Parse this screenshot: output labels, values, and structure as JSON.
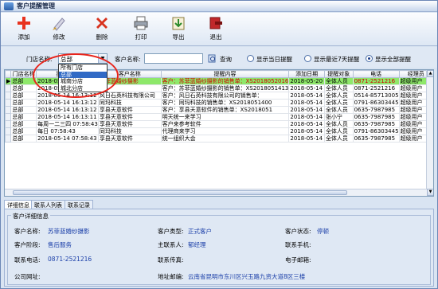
{
  "window": {
    "title": "客户提醒管理"
  },
  "toolbar": {
    "add": "添加",
    "edit": "修改",
    "delete": "删除",
    "print": "打印",
    "export": "导出",
    "exit": "退出"
  },
  "filter": {
    "store_label": "门店名称:",
    "store_value": "总部",
    "store_options": [
      "所有门店",
      "总部",
      "城南分店",
      "城北分店"
    ],
    "store_selected_index": 1,
    "customer_label": "客户名称:",
    "customer_value": "",
    "query_label": "查询",
    "radio_today": "显示当日提醒",
    "radio_week": "显示最近7天提醒",
    "radio_all": "显示全部提醒",
    "radio_selected": "radio_all"
  },
  "grid": {
    "columns": [
      "门店名称",
      "提醒时间",
      "客户名称",
      "提醒内容",
      "添加日期",
      "提醒对象",
      "电话",
      "经理员"
    ],
    "rows": [
      [
        "总部",
        "2018-05-20 15:26:38",
        "苏菲蓝婚纱摄影",
        "客户：苏菲蓝婚纱摄影的销售单：XS2018052016",
        "2018-05-20",
        "全体人员",
        "0871-2521216",
        "超级用户"
      ],
      [
        "总部",
        "2018-05-14 16:13:12",
        "",
        "客户：苏菲蓝婚纱摄影的销售单：XS2018051413",
        "2018-05-14",
        "全体人员",
        "0871-2521216",
        "超级用户"
      ],
      [
        "总部",
        "2018-05-14 16:13:12",
        "风日石英科技有限公司",
        "客户：风日石英科技有限公司的销售单：",
        "2018-05-14",
        "全体人员",
        "0514-85713005",
        "超级用户"
      ],
      [
        "总部",
        "2018-05-14 16:13:12",
        "同玛科技",
        "客户：同玛科技的销售单：XS2018051400",
        "2018-05-14",
        "全体人员",
        "0791-86303445",
        "超级用户"
      ],
      [
        "总部",
        "2018-05-14 16:13:12",
        "享县天意软件",
        "客户：享县天意软件的销售单：XS2018051",
        "2018-05-14",
        "全体人员",
        "0635-7987985",
        "超级用户"
      ],
      [
        "总部",
        "2018-05-14 16:13:11",
        "享县天意软件",
        "明天统一来学习",
        "2018-05-14",
        "张小宁",
        "0635-7987985",
        "超级用户"
      ],
      [
        "总部",
        "每周一二三四 07:58:43",
        "享县天意软件",
        "客户来参考软件",
        "2018-05-14",
        "全体人员",
        "0635-7987985",
        "超级用户"
      ],
      [
        "总部",
        "每日 07:58:43",
        "同玛科技",
        "代理商来学习",
        "2018-05-14",
        "全体人员",
        "0791-86303445",
        "超级用户"
      ],
      [
        "总部",
        "2018-05-14 07:58:43",
        "享县天意软件",
        "统一组织大会",
        "2018-05-14",
        "全体人员",
        "0635-7987985",
        "超级用户"
      ]
    ]
  },
  "tabs": [
    "详细信息",
    "联系人列表",
    "联系记录"
  ],
  "detail": {
    "section_title": "客户详细信息",
    "customer_name_label": "客户名称:",
    "customer_name": "苏菲蓝婚纱摄影",
    "customer_type_label": "客户类型:",
    "customer_type": "正式客户",
    "customer_status_label": "客户状态:",
    "customer_status": "停顿",
    "customer_stage_label": "客户阶段:",
    "customer_stage": "售后服务",
    "main_contact_label": "主联系人:",
    "main_contact": "郁经理",
    "contact_phone_label": "联系手机:",
    "contact_phone": "",
    "tel_label": "联系电话:",
    "tel": "0871-2521216",
    "fax_label": "联系传真:",
    "fax": "",
    "email_label": "电子邮箱:",
    "email": "",
    "website_label": "公司网址:",
    "website": "",
    "address_label": "地址邮编:",
    "address": "云南省昆明市东川区兴玉路九资大道8区三楼"
  },
  "colors": {
    "highlight_row": "#8ee86a",
    "accent_text": "#1a3ea8",
    "red_ring": "#e8241b"
  }
}
